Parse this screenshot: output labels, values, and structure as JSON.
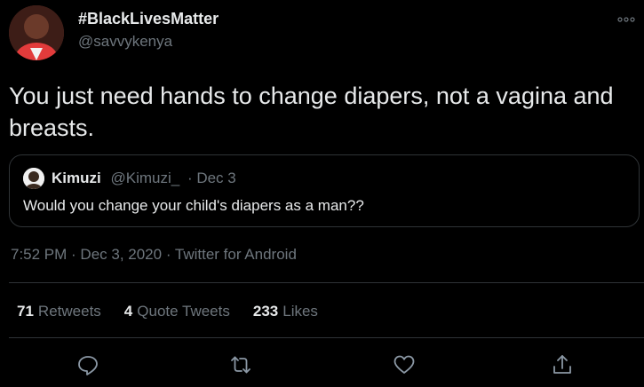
{
  "author": {
    "display_name": "#BlackLivesMatter",
    "handle": "@savvykenya",
    "avatar_icon": "profile-photo"
  },
  "tweet": {
    "text": "You just need hands to change diapers, not a vagina and breasts."
  },
  "quoted_tweet": {
    "name": "Kimuzi",
    "handle": "@Kimuzi_",
    "date": "· Dec 3",
    "text": "Would you change your child's diapers as a man??"
  },
  "meta": {
    "timestamp": "7:52 PM · Dec 3, 2020 · Twitter for Android"
  },
  "stats": {
    "retweets_count": "71",
    "retweets_label": "Retweets",
    "quotes_count": "4",
    "quotes_label": "Quote Tweets",
    "likes_count": "233",
    "likes_label": "Likes"
  },
  "actions": [
    "reply-icon",
    "retweet-icon",
    "like-icon",
    "share-icon"
  ],
  "colors": {
    "background": "#000000",
    "text": "#e7e9ea",
    "secondary": "#6e767d",
    "border": "#2f3336"
  }
}
